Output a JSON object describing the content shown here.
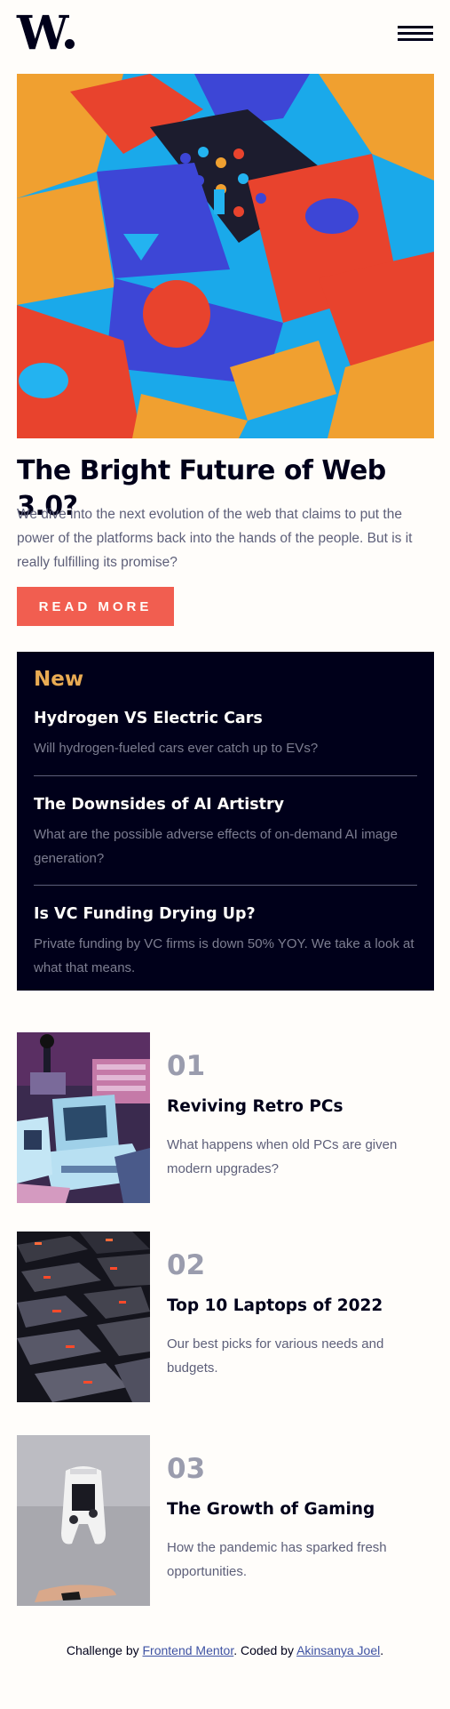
{
  "header": {
    "logo_text": "W",
    "menu_label": "Open menu"
  },
  "hero": {
    "image_alt": "Colorful abstract 3D geometric shapes",
    "title": "The Bright Future of Web 3.0?",
    "description": "We dive into the next evolution of the web that claims to put the power of the platforms back into the hands of the people. But is it really fulfilling its promise?",
    "button_label": "READ MORE"
  },
  "new_section": {
    "heading": "New",
    "items": [
      {
        "title": "Hydrogen VS Electric Cars",
        "description": "Will hydrogen-fueled cars ever catch up to EVs?"
      },
      {
        "title": "The Downsides of AI Artistry",
        "description": "What are the possible adverse effects of on-demand AI image generation?"
      },
      {
        "title": "Is VC Funding Drying Up?",
        "description": "Private funding by VC firms is down 50% YOY. We take a look at what that means."
      }
    ]
  },
  "featured": [
    {
      "number": "01",
      "title": "Reviving Retro PCs",
      "description": "What happens when old PCs are given modern upgrades?"
    },
    {
      "number": "02",
      "title": "Top 10 Laptops of 2022",
      "description": "Our best picks for various needs and budgets."
    },
    {
      "number": "03",
      "title": "The Growth of Gaming",
      "description": "How the pandemic has sparked fresh opportunities."
    }
  ],
  "footer": {
    "prefix": "Challenge by ",
    "link1": "Frontend Mentor",
    "middle": ". Coded by ",
    "link2": "Akinsanya Joel",
    "suffix": "."
  },
  "colors": {
    "accent_red": "#f15e50",
    "accent_orange": "#e9ab53",
    "dark_navy": "#00001a",
    "grayish_blue": "#5d5f79",
    "off_white": "#fffdfa"
  }
}
